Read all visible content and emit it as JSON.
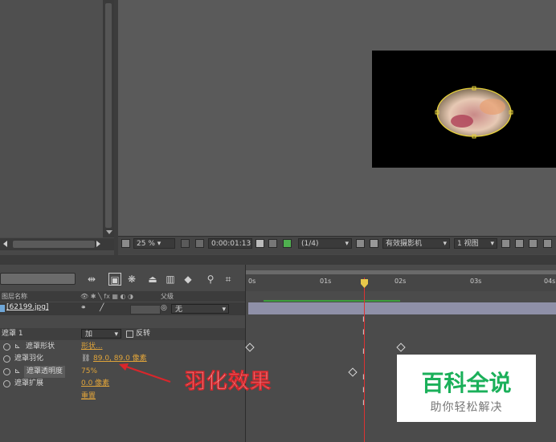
{
  "viewer": {
    "zoom": "25 %",
    "timecode": "0:00:01:13",
    "resolution": "(1/4)",
    "camera": "有效摄影机",
    "views": "1 视图"
  },
  "timeline": {
    "column_header_name": "图层名称",
    "column_header_mode": "父级",
    "layer_name": "[62199.jpg]",
    "parent_value": "无",
    "ruler_ticks": [
      "0s",
      "01s",
      "02s",
      "03s",
      "04s"
    ]
  },
  "mask": {
    "name": "遮罩 1",
    "mode": "加",
    "invert_label": "反转",
    "properties": [
      {
        "label": "遮罩形状",
        "value": "形状..."
      },
      {
        "label": "遮罩羽化",
        "value": "89.0, 89.0 像素"
      },
      {
        "label": "遮罩透明度",
        "value": "75%"
      },
      {
        "label": "遮罩扩展",
        "value": "0.0 像素"
      }
    ],
    "reset_label": "重置"
  },
  "annotation": {
    "text": "羽化效果",
    "color": "#d9262b"
  },
  "watermark": {
    "title": "百科全说",
    "subtitle": "助你轻松解决",
    "title_color": "#1bb05a"
  }
}
